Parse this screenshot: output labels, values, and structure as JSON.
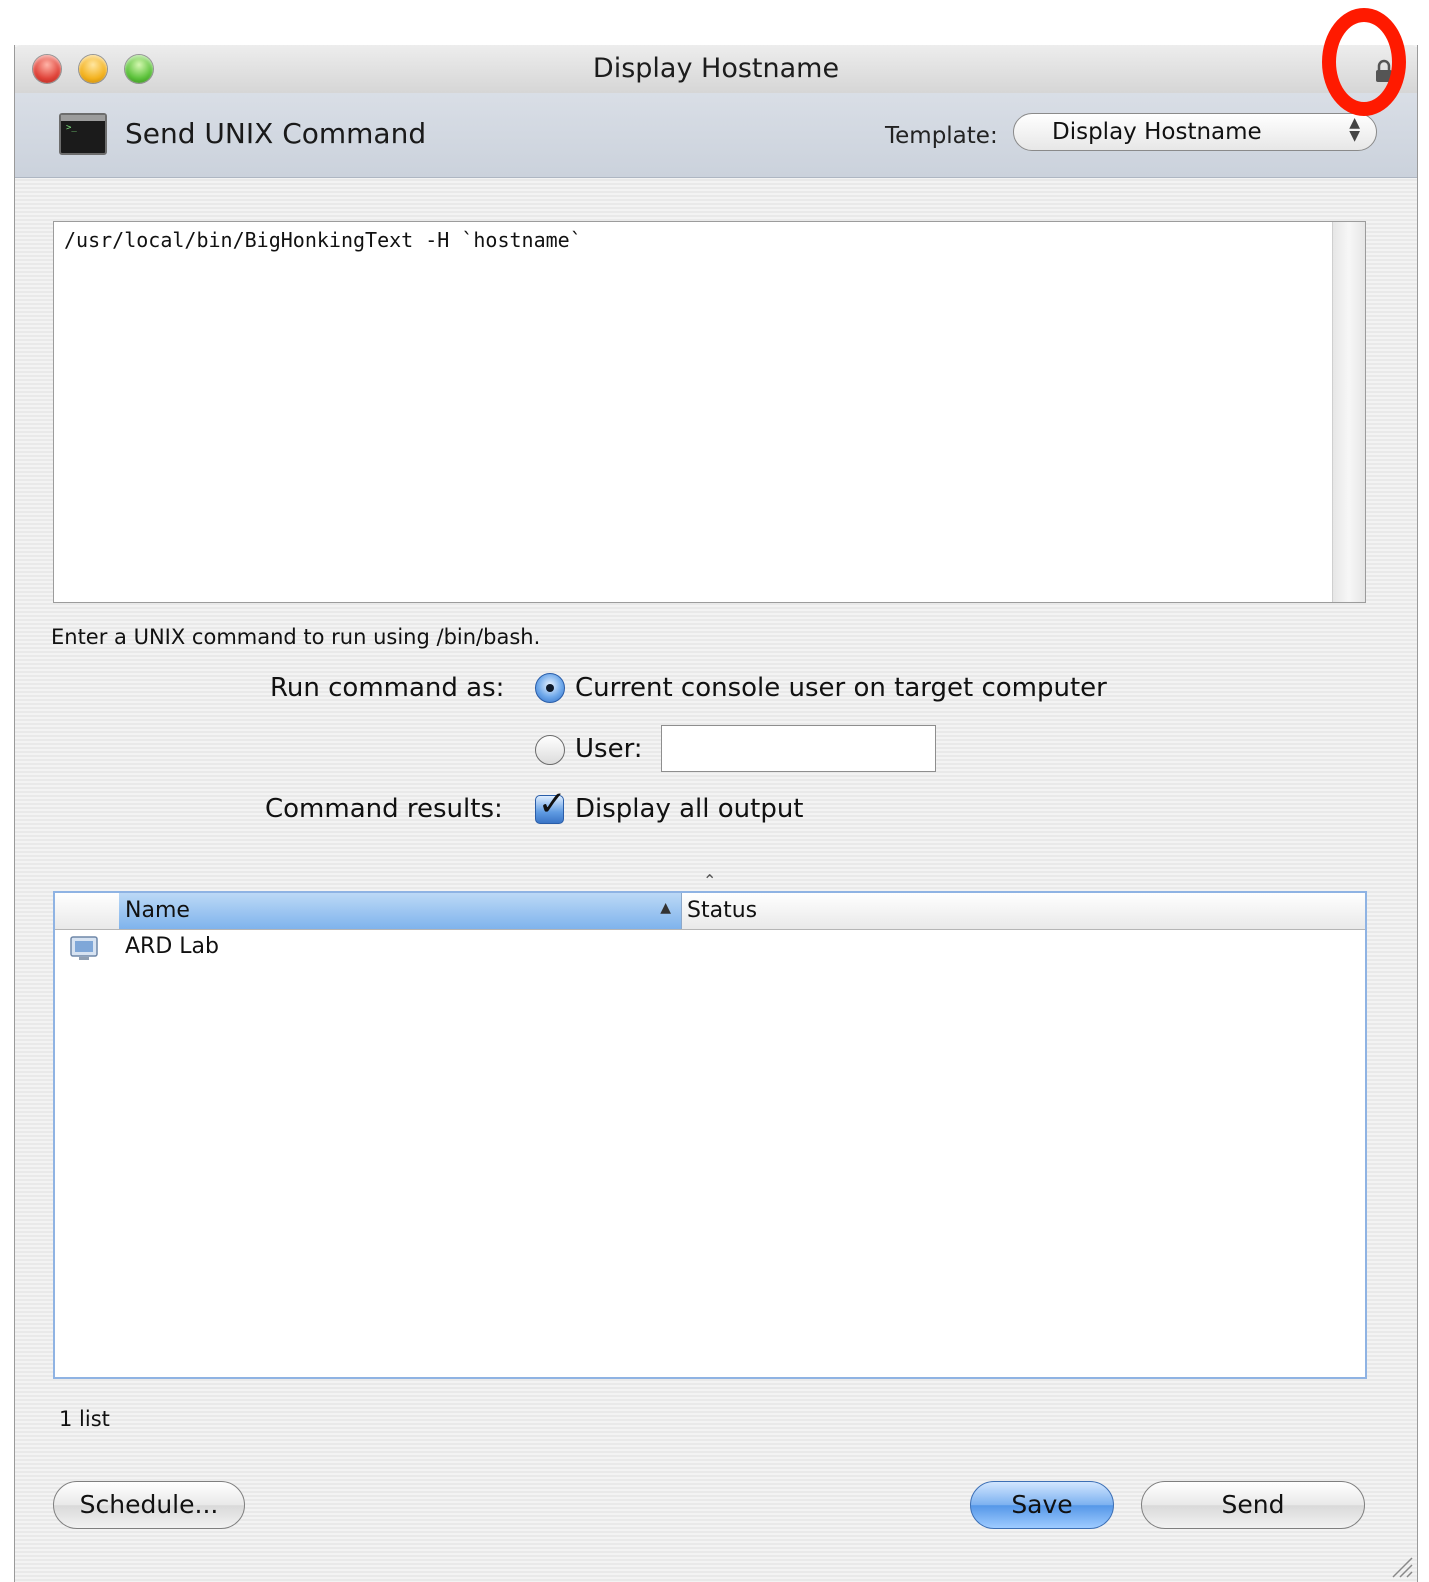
{
  "window": {
    "title": "Display Hostname"
  },
  "header": {
    "title": "Send UNIX Command",
    "template_label": "Template:",
    "template_value": "Display Hostname"
  },
  "command": {
    "text": "/usr/local/bin/BigHonkingText -H `hostname`"
  },
  "hint": "Enter a UNIX command to run using /bin/bash.",
  "run_as": {
    "label": "Run command as:",
    "option_console": "Current console user on target computer",
    "option_user": "User:",
    "user_value": ""
  },
  "results": {
    "label": "Command results:",
    "checkbox_label": "Display all output",
    "checked": true
  },
  "table": {
    "columns": [
      "Name",
      "Status"
    ],
    "rows": [
      {
        "name": "ARD Lab",
        "status": ""
      }
    ]
  },
  "footer": {
    "count": "1 list",
    "schedule_label": "Schedule...",
    "save_label": "Save",
    "send_label": "Send"
  },
  "colors": {
    "accent": "#5597e8",
    "highlight_ring": "#ff1a00"
  }
}
